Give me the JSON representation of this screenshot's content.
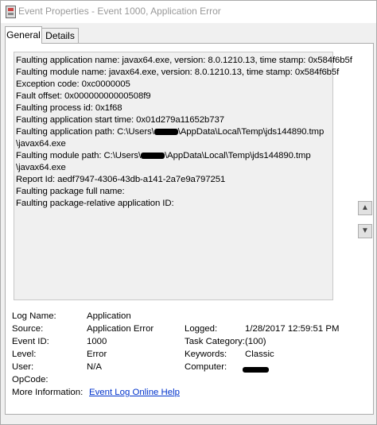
{
  "window": {
    "title": "Event Properties - Event 1000, Application Error"
  },
  "tabs": [
    {
      "label": "General",
      "selected": true
    },
    {
      "label": "Details",
      "selected": false
    }
  ],
  "description": [
    "Faulting application name: javax64.exe, version: 8.0.1210.13, time stamp: 0x584f6b5f",
    "Faulting module name: javax64.exe, version: 8.0.1210.13, time stamp: 0x584f6b5f",
    "Exception code: 0xc0000005",
    "Fault offset: 0x00000000000508f9",
    "Faulting process id: 0x1f68",
    "Faulting application start time: 0x01d279a11652b737",
    {
      "before": "Faulting application path: C:\\Users\\",
      "after": "\\AppData\\Local\\Temp\\jds144890.tmp"
    },
    "\\javax64.exe",
    {
      "before": "Faulting module path: C:\\Users\\",
      "after": "\\AppData\\Local\\Temp\\jds144890.tmp"
    },
    "\\javax64.exe",
    "Report Id: aedf7947-4306-43db-a141-2a7e9a797251",
    "Faulting package full name:",
    "Faulting package-relative application ID:"
  ],
  "scroll": {
    "up_icon": "up-arrow-icon",
    "down_icon": "down-arrow-icon"
  },
  "fields": {
    "log_name": {
      "label": "Log Name:",
      "value": "Application"
    },
    "source": {
      "label": "Source:",
      "value": "Application Error"
    },
    "logged": {
      "label": "Logged:",
      "value": "1/28/2017 12:59:51 PM"
    },
    "event_id": {
      "label": "Event ID:",
      "value": "1000"
    },
    "task_category": {
      "label": "Task Category:",
      "value": "(100)"
    },
    "level": {
      "label": "Level:",
      "value": "Error"
    },
    "keywords": {
      "label": "Keywords:",
      "value": "Classic"
    },
    "user": {
      "label": "User:",
      "value": "N/A"
    },
    "computer": {
      "label": "Computer:",
      "value": ""
    },
    "opcode": {
      "label": "OpCode:",
      "value": ""
    },
    "more_info": {
      "label": "More Information:",
      "link": "Event Log Online Help"
    }
  }
}
